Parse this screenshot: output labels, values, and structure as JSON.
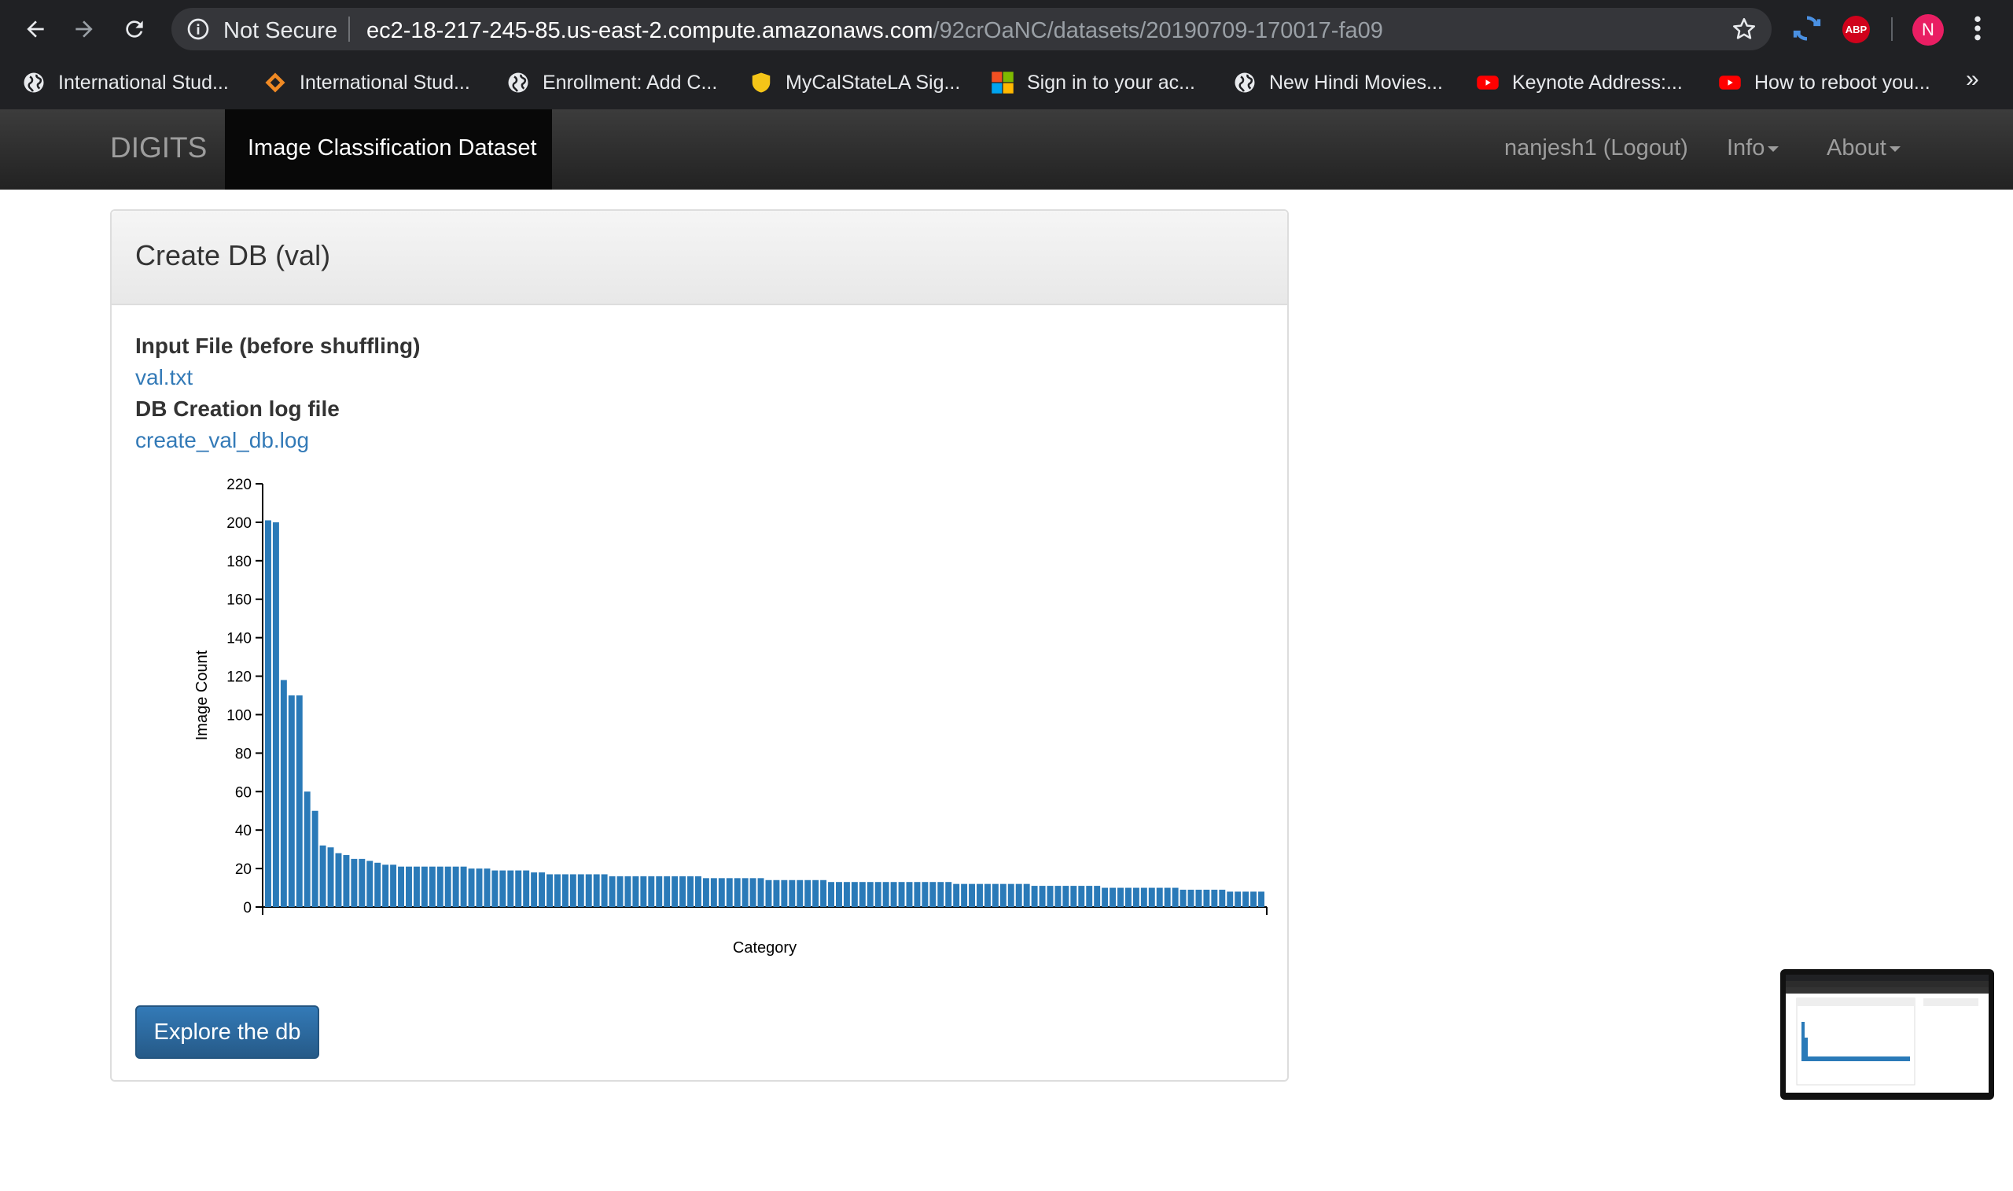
{
  "browser": {
    "security_label": "Not Secure",
    "url_host": "ec2-18-217-245-85.us-east-2.compute.amazonaws.com",
    "url_path": "/92crOaNC/datasets/20190709-170017-fa09",
    "extension_abp": "ABP",
    "profile_initial": "N",
    "bookmarks": [
      {
        "label": "International Stud...",
        "icon": "globe-icon"
      },
      {
        "label": "International Stud...",
        "icon": "orange-diamond-icon"
      },
      {
        "label": "Enrollment: Add C...",
        "icon": "globe-icon"
      },
      {
        "label": "MyCalStateLA Sig...",
        "icon": "yellow-shield-icon"
      },
      {
        "label": "Sign in to your ac...",
        "icon": "microsoft-icon"
      },
      {
        "label": "New Hindi Movies...",
        "icon": "globe-icon"
      },
      {
        "label": "Keynote Address:...",
        "icon": "youtube-icon"
      },
      {
        "label": "How to reboot you...",
        "icon": "youtube-icon"
      }
    ],
    "bookmarks_more": "»"
  },
  "navbar": {
    "brand": "DIGITS",
    "active": "Image Classification Dataset",
    "user": "nanjesh1 (Logout)",
    "info": "Info",
    "about": "About"
  },
  "panel": {
    "title": "Create DB (val)",
    "input_label": "Input File (before shuffling)",
    "input_link": "val.txt",
    "log_label": "DB Creation log file",
    "log_link": "create_val_db.log",
    "button": "Explore the db"
  },
  "chart_data": {
    "type": "bar",
    "xlabel": "Category",
    "ylabel": "Image Count",
    "ylim": [
      0,
      220
    ],
    "yticks": [
      0,
      20,
      40,
      60,
      80,
      100,
      120,
      140,
      160,
      180,
      200,
      220
    ],
    "color": "#2a7ab8",
    "values": [
      201,
      200,
      118,
      110,
      110,
      60,
      50,
      32,
      31,
      28,
      27,
      25,
      25,
      24,
      23,
      22,
      22,
      21,
      21,
      21,
      21,
      21,
      21,
      21,
      21,
      21,
      20,
      20,
      20,
      19,
      19,
      19,
      19,
      19,
      18,
      18,
      17,
      17,
      17,
      17,
      17,
      17,
      17,
      17,
      16,
      16,
      16,
      16,
      16,
      16,
      16,
      16,
      16,
      16,
      16,
      16,
      15,
      15,
      15,
      15,
      15,
      15,
      15,
      15,
      14,
      14,
      14,
      14,
      14,
      14,
      14,
      14,
      13,
      13,
      13,
      13,
      13,
      13,
      13,
      13,
      13,
      13,
      13,
      13,
      13,
      13,
      13,
      13,
      12,
      12,
      12,
      12,
      12,
      12,
      12,
      12,
      12,
      12,
      11,
      11,
      11,
      11,
      11,
      11,
      11,
      11,
      11,
      10,
      10,
      10,
      10,
      10,
      10,
      10,
      10,
      10,
      10,
      9,
      9,
      9,
      9,
      9,
      9,
      8,
      8,
      8,
      8,
      8
    ]
  }
}
